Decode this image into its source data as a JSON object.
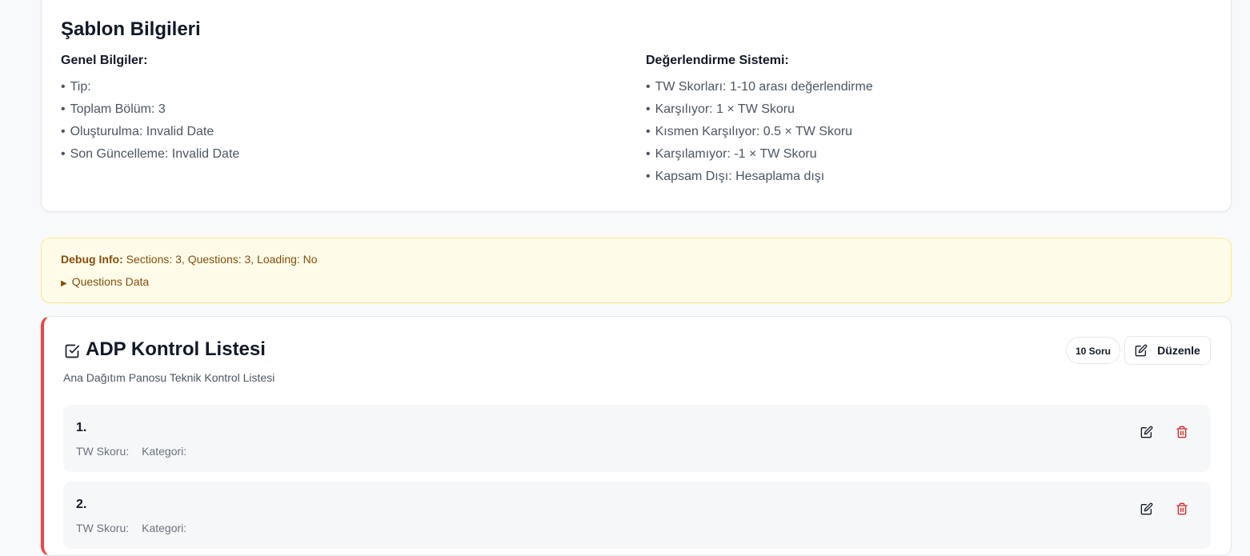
{
  "info": {
    "title": "Şablon Bilgileri",
    "general_heading": "Genel Bilgiler:",
    "general_items": [
      "Tip:",
      "Toplam Bölüm: 3",
      "Oluşturulma: Invalid Date",
      "Son Güncelleme: Invalid Date"
    ],
    "scoring_heading": "Değerlendirme Sistemi:",
    "scoring_items": [
      "TW Skorları: 1-10 arası değerlendirme",
      "Karşılıyor: 1 × TW Skoru",
      "Kısmen Karşılıyor: 0.5 × TW Skoru",
      "Karşılamıyor: -1 × TW Skoru",
      "Kapsam Dışı: Hesaplama dışı"
    ]
  },
  "debug": {
    "label": "Debug Info:",
    "text": "Sections: 3, Questions: 3, Loading: No",
    "toggle_label": "Questions Data"
  },
  "section": {
    "title": "ADP Kontrol Listesi",
    "description": "Ana Dağıtım Panosu Teknik Kontrol Listesi",
    "badge": "10 Soru",
    "edit_label": "Düzenle",
    "accent_color": "#ef4444",
    "questions": [
      {
        "number": "1.",
        "tw_label": "TW Skoru:",
        "category_label": "Kategori:"
      },
      {
        "number": "2.",
        "tw_label": "TW Skoru:",
        "category_label": "Kategori:"
      }
    ]
  },
  "colors": {
    "danger": "#dc2626",
    "debug_bg": "#fefce8",
    "debug_text": "#854d0e"
  }
}
